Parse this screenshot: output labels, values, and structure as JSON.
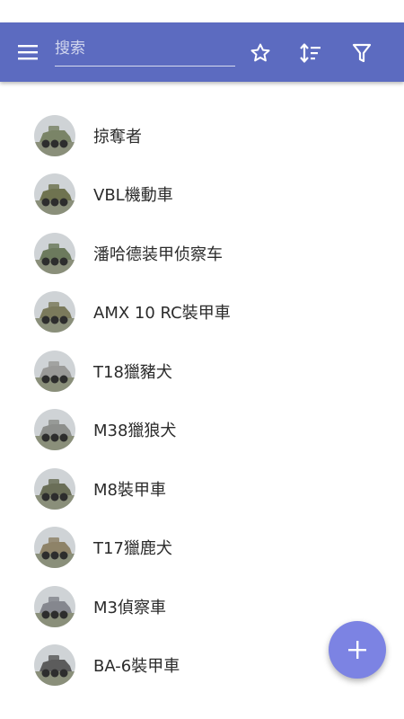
{
  "toolbar": {
    "search_placeholder": "搜索",
    "background_color": "#5c6bc0",
    "icons": [
      "menu-icon",
      "star-outline-icon",
      "sort-icon",
      "filter-icon"
    ]
  },
  "list": {
    "items": [
      {
        "label": "掠奪者",
        "avatar_color": "#7a8467"
      },
      {
        "label": "VBL機動車",
        "avatar_color": "#6f7350"
      },
      {
        "label": "潘哈德装甲侦察车",
        "avatar_color": "#6c7a5d"
      },
      {
        "label": "AMX 10 RC裝甲車",
        "avatar_color": "#7b7a5c"
      },
      {
        "label": "T18獵豬犬",
        "avatar_color": "#9a9a98"
      },
      {
        "label": "M38獵狼犬",
        "avatar_color": "#8d8f8c"
      },
      {
        "label": "M8裝甲車",
        "avatar_color": "#6a6e57"
      },
      {
        "label": "T17獵鹿犬",
        "avatar_color": "#8e8368"
      },
      {
        "label": "M3偵察車",
        "avatar_color": "#85878e"
      },
      {
        "label": "BA-6裝甲車",
        "avatar_color": "#5c5c5c"
      }
    ]
  },
  "fab": {
    "icon": "plus-icon",
    "color": "#7c83e3"
  }
}
